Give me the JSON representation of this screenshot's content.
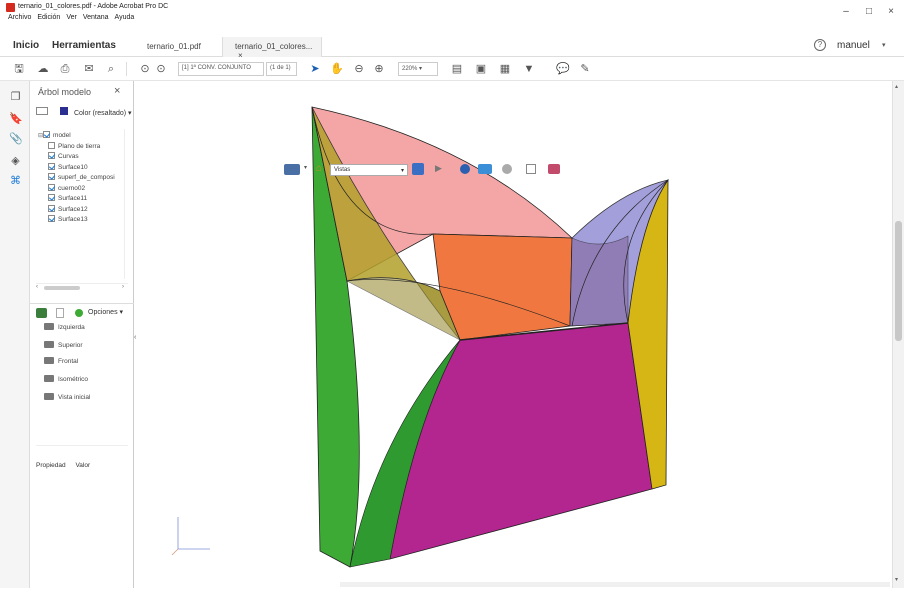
{
  "window": {
    "title": "ternario_01_colores.pdf - Adobe Acrobat Pro DC",
    "menus": [
      "Archivo",
      "Edición",
      "Ver",
      "Ventana",
      "Ayuda"
    ],
    "minimize": "–",
    "maximize": "□",
    "close": "×"
  },
  "tabs": {
    "home": "Inicio",
    "tools": "Herramientas",
    "doc1": "ternario_01.pdf",
    "doc2": "ternario_01_colores...",
    "doc2_close": "×",
    "help": "?",
    "user": "manuel"
  },
  "toolbar": {
    "page_view": "[1] 1ª CONV. CONJUNTO",
    "page_count": "(1 de 1)",
    "zoom": "220%"
  },
  "model_tree": {
    "title": "Árbol modelo",
    "close": "×",
    "color_label": "Color (resaltado)",
    "items": [
      {
        "label": "model",
        "checked": true,
        "root": true
      },
      {
        "label": "Plano de tierra",
        "checked": false
      },
      {
        "label": "Curvas",
        "checked": true
      },
      {
        "label": "Surface10",
        "checked": true
      },
      {
        "label": "superf_de_composi",
        "checked": true
      },
      {
        "label": "cuerno02",
        "checked": true
      },
      {
        "label": "Surface11",
        "checked": true
      },
      {
        "label": "Surface12",
        "checked": true
      },
      {
        "label": "Surface13",
        "checked": true
      }
    ]
  },
  "views": {
    "options_label": "Opciones",
    "items": [
      "Izquierda",
      "Superior",
      "Frontal",
      "Isométrico",
      "Vista inicial"
    ]
  },
  "properties": {
    "col1": "Propiedad",
    "col2": "Valor"
  },
  "model_toolbar": {
    "views_label": "Vistas"
  },
  "colors": {
    "green": "#3daa35",
    "magenta": "#b3258f",
    "pink": "#f4a6a6",
    "orange": "#f07840",
    "olive": "#b3a12b",
    "lavender": "#9a95d6",
    "yellow": "#d6b614"
  }
}
